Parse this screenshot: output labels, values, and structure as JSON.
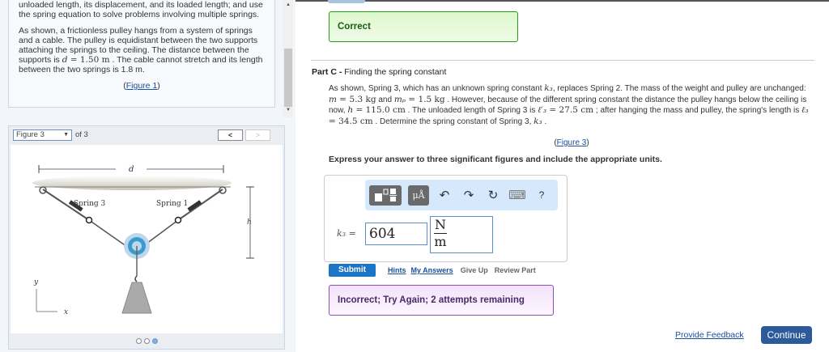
{
  "intro": {
    "p1": "unloaded length, its displacement, and its loaded length; and use the spring equation to solve problems involving multiple springs.",
    "p2a": "As shown, a frictionless pulley hangs from a system of springs and a cable. The pulley is equidistant between the two supports attaching the springs to the ceiling. The distance between the supports is ",
    "p2m": "d",
    "p2v": " = 1.50 m",
    "p2b": " . The cable cannot stretch and its length between the two springs is 1.8 m.",
    "fig_open": "(",
    "fig_link": "Figure 1",
    "fig_close": ")"
  },
  "figure": {
    "selected": "Figure 3",
    "of": "of 3",
    "prev": "<",
    "next": ">",
    "labels": {
      "d": "d",
      "h": "h",
      "spring_left": "Spring 3",
      "spring_right": "Spring 1",
      "y": "y",
      "x": "x"
    },
    "pages": 3,
    "current_page": 3
  },
  "feedback_correct": "Correct",
  "part": {
    "label": "Part C",
    "sep": " - ",
    "title": "Finding the spring constant"
  },
  "problem": [
    {
      "t": "As shown, Spring 3, which has an unknown spring constant "
    },
    {
      "m": "k₃"
    },
    {
      "t": ", replaces Spring 2. The mass of the weight and pulley are unchanged: "
    },
    {
      "m": "m"
    },
    {
      "r": " = 5.3 kg"
    },
    {
      "t": " and "
    },
    {
      "m": "mₚ"
    },
    {
      "r": " = 1.5 kg"
    },
    {
      "t": " . However, because of the different spring constant the distance the pulley hangs below the ceiling is now, "
    },
    {
      "m": "h"
    },
    {
      "r": " = 115.0 cm"
    },
    {
      "t": " . The unloaded length of Spring 3 is "
    },
    {
      "m": "ℓ′₃"
    },
    {
      "r": " = 27.5 cm"
    },
    {
      "t": " ; after hanging the mass and pulley, the spring's length is "
    },
    {
      "m": "ℓ₃"
    },
    {
      "r": " = 34.5 cm"
    },
    {
      "t": " . Determine the spring constant of Spring 3, "
    },
    {
      "m": "k₃"
    },
    {
      "t": " ."
    }
  ],
  "figure3_link": "Figure 3",
  "instruction": "Express your answer to three significant figures and include the appropriate units.",
  "toolbar": {
    "units": "μÅ",
    "undo": "↶",
    "redo": "↷",
    "reset": "↻",
    "keyboard": "⌨",
    "help": "?"
  },
  "answer": {
    "label": "k₃ =",
    "value": "604",
    "unit_num": "N",
    "unit_den": "m"
  },
  "actions": {
    "submit": "Submit",
    "hints": "Hints",
    "my_answers": "My Answers",
    "give_up": "Give Up",
    "review": "Review Part"
  },
  "feedback_incorrect": "Incorrect; Try Again; 2 attempts remaining",
  "footer": {
    "provide_feedback": "Provide Feedback",
    "continue": "Continue"
  }
}
